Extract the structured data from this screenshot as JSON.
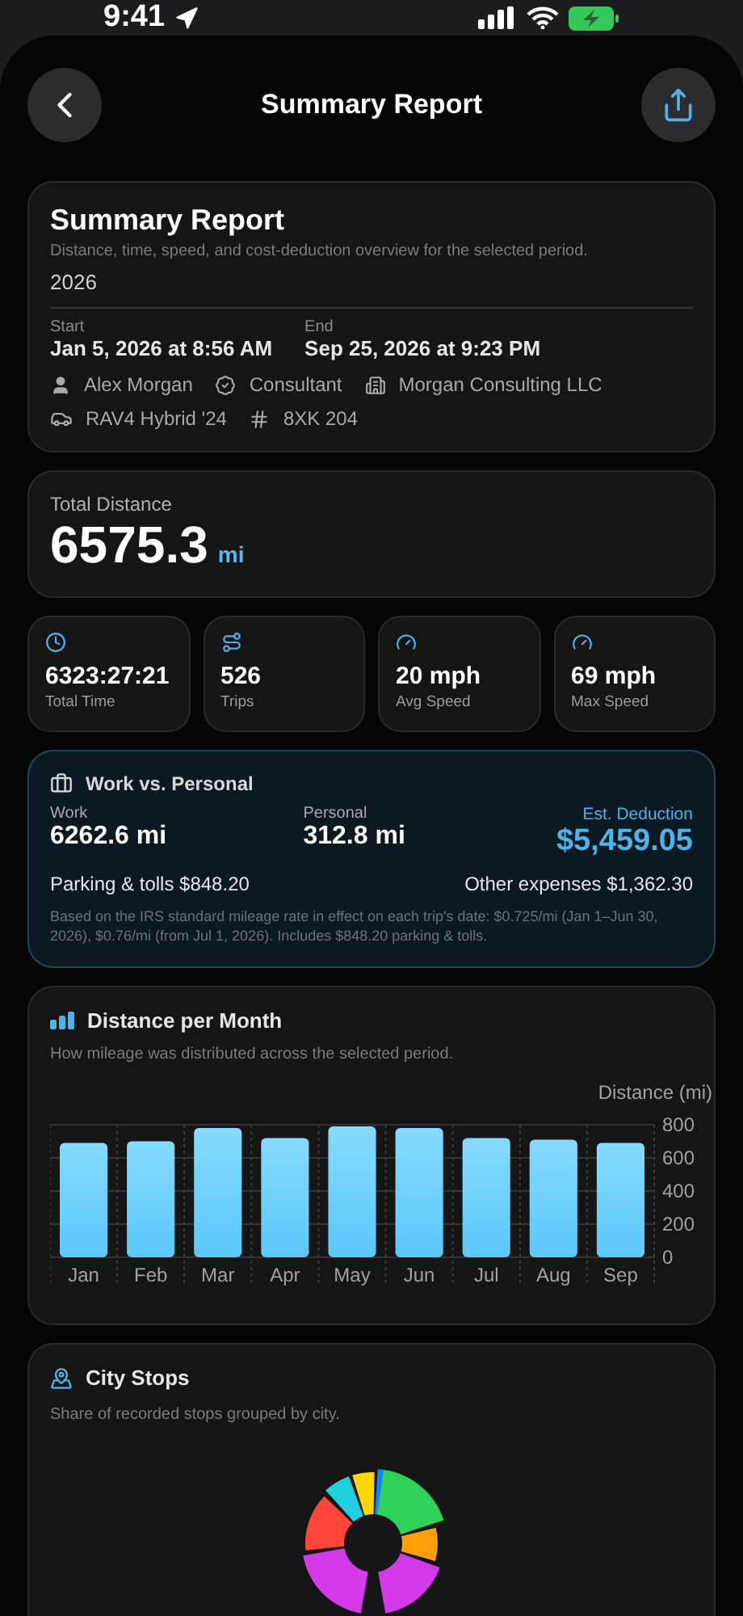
{
  "status_bar": {
    "time": "9:41"
  },
  "nav": {
    "title": "Summary Report"
  },
  "summary": {
    "title": "Summary Report",
    "subtitle": "Distance, time, speed, and cost-deduction overview for the selected period.",
    "period": "2026",
    "start_label": "Start",
    "start": "Jan 5, 2026 at 8:56 AM",
    "end_label": "End",
    "end": "Sep 25, 2026 at 9:23 PM",
    "person": "Alex Morgan",
    "role": "Consultant",
    "company": "Morgan Consulting LLC",
    "vehicle": "RAV4 Hybrid '24",
    "plate": "8XK 204"
  },
  "total_distance": {
    "label": "Total Distance",
    "value": "6575.3",
    "unit": "mi"
  },
  "stats": [
    {
      "kind": "time",
      "value": "6323:27:21",
      "label": "Total Time"
    },
    {
      "kind": "trips",
      "value": "526",
      "label": "Trips"
    },
    {
      "kind": "speed",
      "value": "20 mph",
      "label": "Avg Speed"
    },
    {
      "kind": "speed",
      "value": "69 mph",
      "label": "Max Speed"
    }
  ],
  "work_personal": {
    "title": "Work vs. Personal",
    "work_label": "Work",
    "work": "6262.6 mi",
    "personal_label": "Personal",
    "personal": "312.8 mi",
    "deduction_label": "Est. Deduction",
    "deduction": "$5,459.05",
    "parking": "Parking & tolls $848.20",
    "other": "Other expenses $1,362.30",
    "note": "Based on the IRS standard mileage rate in effect on each trip's date: $0.725/mi (Jan 1–Jun 30, 2026), $0.76/mi (from Jul 1, 2026). Includes $848.20 parking & tolls."
  },
  "monthly": {
    "title": "Distance per Month",
    "subtitle": "How mileage was distributed across the selected period.",
    "chart_data": {
      "type": "bar",
      "ylabel": "Distance (mi)",
      "categories": [
        "Jan",
        "Feb",
        "Mar",
        "Apr",
        "May",
        "Jun",
        "Jul",
        "Aug",
        "Sep"
      ],
      "values": [
        690,
        700,
        780,
        720,
        790,
        780,
        720,
        710,
        690
      ],
      "grid": true,
      "ylim": [
        0,
        800
      ],
      "yticks": [
        0,
        200,
        400,
        600,
        800
      ]
    }
  },
  "city_stops": {
    "title": "City Stops",
    "subtitle": "Share of recorded stops grouped by city."
  }
}
